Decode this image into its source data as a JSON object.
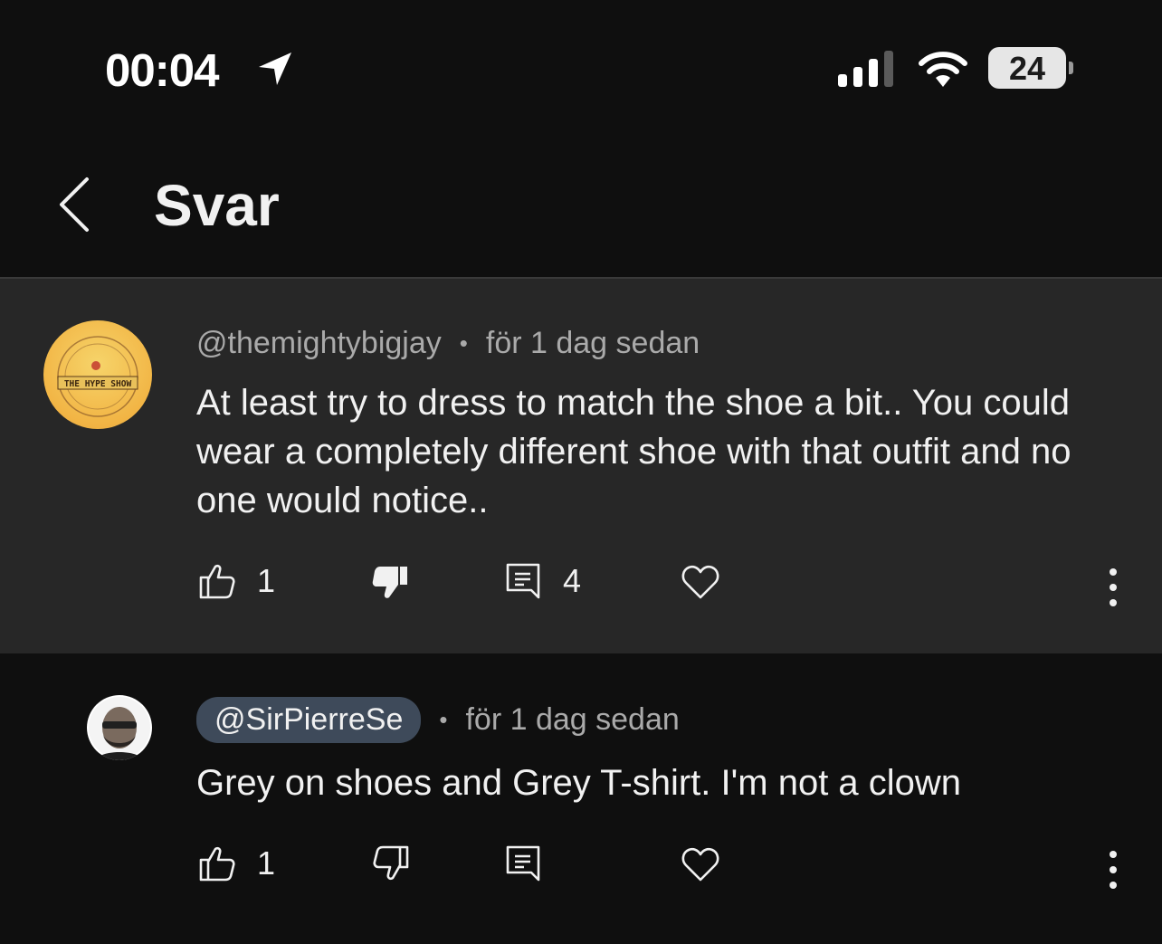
{
  "status_bar": {
    "time": "00:04",
    "battery": "24"
  },
  "header": {
    "title": "Svar"
  },
  "comments": [
    {
      "handle": "@themightybigjay",
      "timestamp": "för 1 dag sedan",
      "text": "At least try to dress to match the shoe a bit.. You could wear a completely different shoe with that outfit and no one would notice..",
      "avatar_text": "THE HYPE SHOW",
      "likes": "1",
      "replies": "4",
      "disliked": true
    },
    {
      "handle": "@SirPierreSe",
      "timestamp": "för 1 dag sedan",
      "text": "Grey on shoes and Grey T-shirt. I'm not a clown",
      "likes": "1",
      "disliked": false
    }
  ],
  "colors": {
    "background": "#0f0f0f",
    "parent_comment_bg": "#272727",
    "handle_chip": "#3e4a5a",
    "secondary_text": "#aaaaaa"
  }
}
